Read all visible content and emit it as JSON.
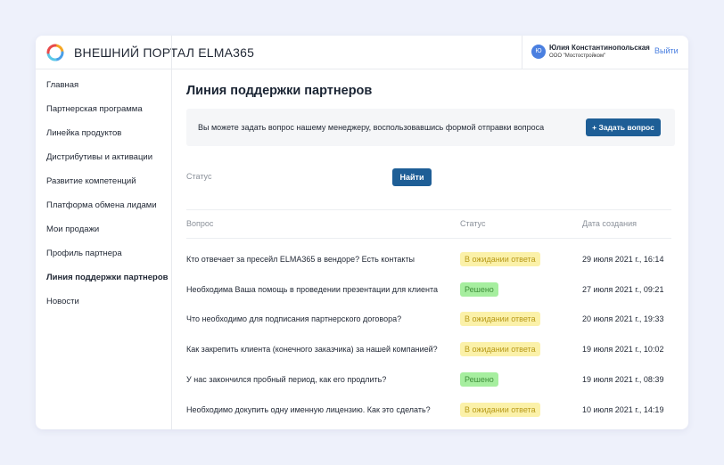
{
  "header": {
    "title": "ВНЕШНИЙ ПОРТАЛ ELMA365",
    "user_initials": "Ю",
    "user_name": "Юлия Константинопольская",
    "user_org": "ООО \"Мостостройком\"",
    "logout": "Выйти"
  },
  "sidebar": {
    "items": [
      {
        "label": "Главная"
      },
      {
        "label": "Партнерская программа"
      },
      {
        "label": "Линейка продуктов"
      },
      {
        "label": "Дистрибутивы и активации"
      },
      {
        "label": "Развитие компетенций"
      },
      {
        "label": "Платформа обмена лидами"
      },
      {
        "label": "Мои продажи"
      },
      {
        "label": "Профиль партнера"
      },
      {
        "label": "Линия поддержки партнеров"
      },
      {
        "label": "Новости"
      }
    ]
  },
  "main": {
    "title": "Линия поддержки партнеров",
    "info_text": "Вы можете задать вопрос нашему менеджеру, воспользовавшись формой отправки вопроса",
    "ask_button": "+ Задать вопрос",
    "filter_status_label": "Статус",
    "find_button": "Найти",
    "columns": [
      "Вопрос",
      "Статус",
      "Дата создания"
    ],
    "rows": [
      {
        "question": "Кто отвечает за пресейл ELMA365 в вендоре? Есть контакты",
        "status": "В ожидании ответа",
        "date": "29 июля 2021 г., 16:14"
      },
      {
        "question": "Необходима Ваша помощь в проведении презентации для клиента",
        "status": "Решено",
        "date": "27 июля 2021 г., 09:21"
      },
      {
        "question": "Что необходимо для подписания партнерского договора?",
        "status": "В ожидании ответа",
        "date": "20 июля 2021 г., 19:33"
      },
      {
        "question": "Как закрепить клиента (конечного заказчика) за нашей компанией?",
        "status": "В ожидании ответа",
        "date": "19 июля 2021 г., 10:02"
      },
      {
        "question": "У нас закончился пробный период, как его продлить?",
        "status": "Решено",
        "date": "19 июля 2021 г., 08:39"
      },
      {
        "question": "Необходимо докупить одну именную лицензию. Как это сделать?",
        "status": "В ожидании ответа",
        "date": "10 июля 2021 г., 14:19"
      }
    ]
  },
  "colors": {
    "accent": "#1e5e96",
    "link": "#4a7fe0",
    "wait_bg": "#fbf1a9",
    "ok_bg": "#a6ee9f"
  }
}
